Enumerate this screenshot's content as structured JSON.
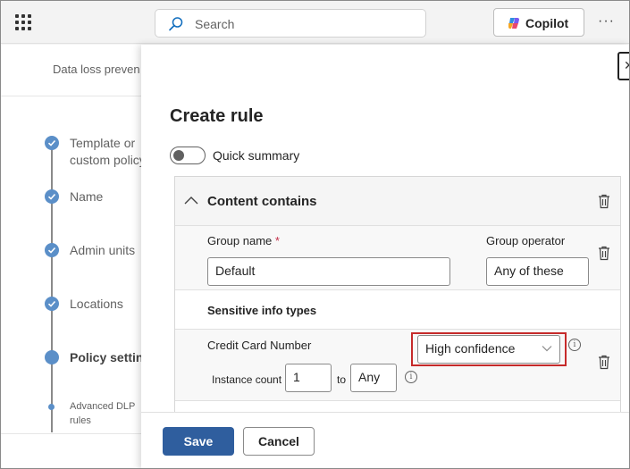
{
  "topbar": {
    "search_placeholder": "Search",
    "copilot_label": "Copilot",
    "more_label": "···"
  },
  "background": {
    "breadcrumb": "Data loss preven",
    "steps": [
      {
        "label_line1": "Template or",
        "label_line2": "custom policy",
        "state": "complete"
      },
      {
        "label_line1": "Name",
        "state": "complete"
      },
      {
        "label_line1": "Admin units",
        "state": "complete"
      },
      {
        "label_line1": "Locations",
        "state": "complete"
      },
      {
        "label_line1": "Policy settings",
        "state": "current"
      },
      {
        "label_line1": "Advanced DLP",
        "label_line2": "rules",
        "state": "substep"
      }
    ]
  },
  "panel": {
    "close_label": "✕",
    "title": "Create rule",
    "quick_summary": {
      "label": "Quick summary",
      "on": false
    },
    "condition": {
      "heading": "Content contains",
      "group_name_label": "Group name",
      "required_marker": "*",
      "group_name_value": "Default",
      "group_operator_label": "Group operator",
      "group_operator_value": "Any of these",
      "sit_heading": "Sensitive info types",
      "sit_items": [
        {
          "name": "Credit Card Number",
          "confidence": "High confidence",
          "instance_count_label": "Instance count",
          "instance_min": "1",
          "to_label": "to",
          "instance_max": "Any"
        }
      ]
    },
    "footer": {
      "save_label": "Save",
      "cancel_label": "Cancel"
    }
  },
  "colors": {
    "primary": "#2f5e9e",
    "step_complete": "#5b8fc8",
    "highlight": "#c62a2a"
  }
}
